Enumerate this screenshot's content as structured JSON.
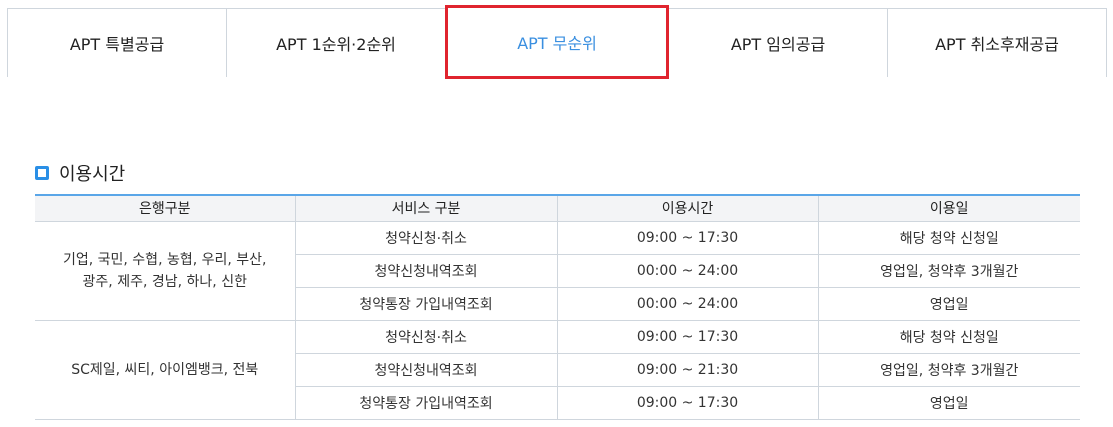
{
  "tabs": [
    {
      "label": "APT 특별공급",
      "active": false
    },
    {
      "label": "APT 1순위·2순위",
      "active": false
    },
    {
      "label": "APT 무순위",
      "active": true
    },
    {
      "label": "APT 임의공급",
      "active": false
    },
    {
      "label": "APT 취소후재공급",
      "active": false
    }
  ],
  "section": {
    "title": "이용시간"
  },
  "table": {
    "headers": [
      "은행구분",
      "서비스 구분",
      "이용시간",
      "이용일"
    ],
    "groups": [
      {
        "bank_line1": "기업, 국민, 수협, 농협, 우리, 부산,",
        "bank_line2": "광주, 제주, 경남, 하나, 신한",
        "rows": [
          {
            "service": "청약신청·취소",
            "time": "09:00 ~ 17:30",
            "day": "해당 청약 신청일"
          },
          {
            "service": "청약신청내역조회",
            "time": "00:00 ~ 24:00",
            "day": "영업일, 청약후 3개월간"
          },
          {
            "service": "청약통장 가입내역조회",
            "time": "00:00 ~ 24:00",
            "day": "영업일"
          }
        ]
      },
      {
        "bank_line1": "SC제일, 씨티, 아이엠뱅크, 전북",
        "bank_line2": "",
        "rows": [
          {
            "service": "청약신청·취소",
            "time": "09:00 ~ 17:30",
            "day": "해당 청약 신청일"
          },
          {
            "service": "청약신청내역조회",
            "time": "09:00 ~ 21:30",
            "day": "영업일, 청약후 3개월간"
          },
          {
            "service": "청약통장 가입내역조회",
            "time": "09:00 ~ 17:30",
            "day": "영업일"
          }
        ]
      }
    ]
  },
  "colors": {
    "accent": "#3a8fe0",
    "highlight_border": "#e0242e",
    "icon": "#2a8fe6"
  }
}
